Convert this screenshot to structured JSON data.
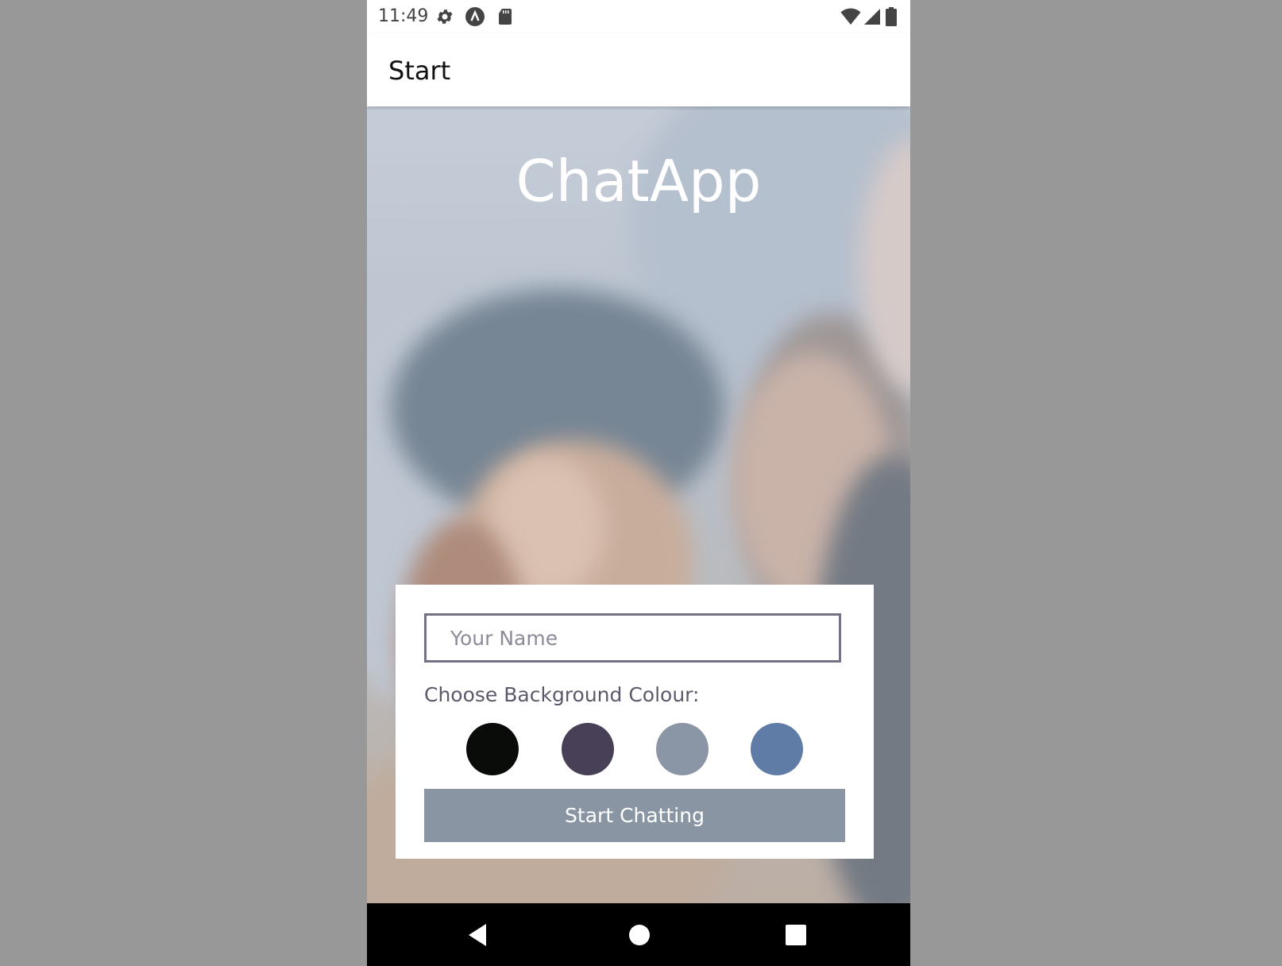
{
  "status_bar": {
    "time": "11:49",
    "left_icons": [
      "gear-icon",
      "a-circle-icon",
      "sd-card-icon"
    ],
    "right_icons": [
      "wifi-icon",
      "signal-icon",
      "battery-icon"
    ]
  },
  "app_bar": {
    "title": "Start"
  },
  "hero": {
    "title": "ChatApp"
  },
  "form": {
    "name_placeholder": "Your Name",
    "name_value": "",
    "choose_label": "Choose Background Colour:",
    "colors": [
      "#090c08",
      "#474056",
      "#8a95a5",
      "#5f7ca6"
    ],
    "start_button_label": "Start Chatting",
    "start_button_color": "#8a95a4"
  },
  "nav_bar": {
    "buttons": [
      "back-icon",
      "home-icon",
      "recents-icon"
    ]
  }
}
